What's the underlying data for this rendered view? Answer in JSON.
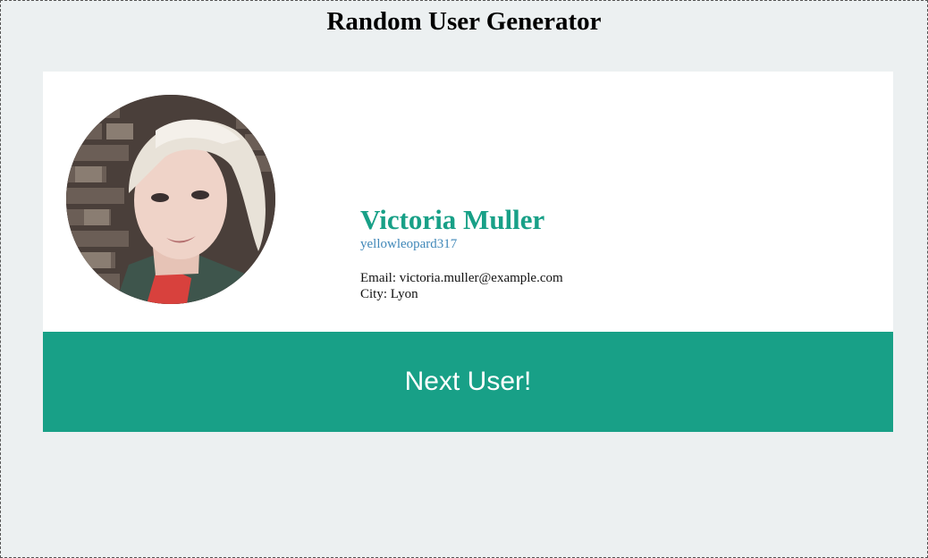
{
  "page": {
    "title": "Random User Generator"
  },
  "user": {
    "name": "Victoria Muller",
    "username": "yellowleopard317",
    "email_label": "Email: ",
    "email": "victoria.muller@example.com",
    "city_label": "City: ",
    "city": "Lyon",
    "avatar_icon": "user-photo"
  },
  "actions": {
    "next_label": "Next User!"
  },
  "colors": {
    "background": "#ecf0f1",
    "card": "#ffffff",
    "accent": "#18a087",
    "username": "#3f87b8"
  }
}
